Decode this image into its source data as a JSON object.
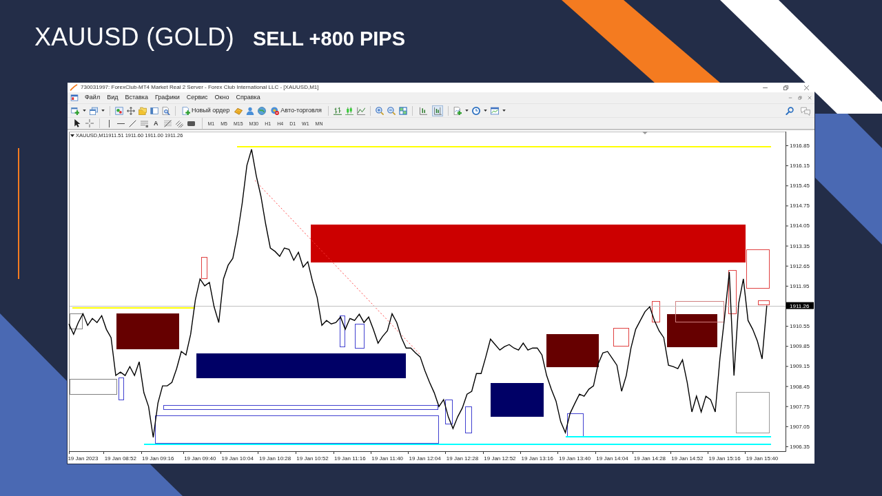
{
  "slide": {
    "title": "XAUUSD (GOLD)",
    "subtitle": "SELL +800 PIPS"
  },
  "window": {
    "title": "730031997: ForexClub-MT4 Market Real 2 Server - Forex Club International LLC - [XAUUSD,M1]"
  },
  "menu": [
    "Файл",
    "Вид",
    "Вставка",
    "Графики",
    "Сервис",
    "Окно",
    "Справка"
  ],
  "toolbar": {
    "order_button": "Новый ордер",
    "autotrading_button": "Авто-торговля",
    "toggles": [
      {
        "pressed": false
      },
      {
        "pressed": true
      }
    ]
  },
  "drawing_toolbar": {
    "text_tool": "A",
    "periods": [
      "M1",
      "M5",
      "M15",
      "M30",
      "H1",
      "H4",
      "D1",
      "W1",
      "MN"
    ]
  },
  "chart": {
    "legend_values": "1911.51 1911.60 1911.00 1911.26",
    "bid_label": "1911.26",
    "chart_data": {
      "type": "line",
      "categories": [
        null,
        null,
        null,
        "19 Jan 2023",
        null,
        null,
        null,
        null,
        null,
        null,
        null,
        "19 Jan 08:52",
        null,
        null,
        null,
        null,
        null,
        null,
        null,
        "19 Jan 09:16",
        null,
        null,
        null,
        null,
        null,
        null,
        null,
        null,
        "19 Jan 09:40",
        null,
        null,
        null,
        null,
        null,
        null,
        null,
        "19 Jan 10:04",
        null,
        null,
        null,
        null,
        null,
        null,
        null,
        "19 Jan 10:28",
        null,
        null,
        null,
        null,
        null,
        null,
        null,
        "19 Jan 10:52",
        null,
        null,
        null,
        null,
        null,
        null,
        null,
        "19 Jan 11:16",
        null,
        null,
        null,
        null,
        null,
        null,
        null,
        "19 Jan 11:40",
        null,
        null,
        null,
        null,
        null,
        null,
        null,
        "19 Jan 12:04",
        null,
        null,
        null,
        null,
        null,
        null,
        null,
        "19 Jan 12:28",
        null,
        null,
        null,
        null,
        null,
        null,
        null,
        "19 Jan 12:52",
        null,
        null,
        null,
        null,
        null,
        null,
        null,
        "19 Jan 13:16",
        null,
        null,
        null,
        null,
        null,
        null,
        null,
        "19 Jan 13:40",
        null,
        null,
        null,
        null,
        null,
        null,
        null,
        "19 Jan 14:04",
        null,
        null,
        null,
        null,
        null,
        null,
        null,
        "19 Jan 14:28",
        null,
        null,
        null,
        null,
        null,
        null,
        null,
        "19 Jan 14:52",
        null,
        null,
        null,
        null,
        null,
        null,
        null,
        "19 Jan 15:16",
        null,
        null,
        null,
        null,
        null,
        null,
        null,
        "19 Jan 15:40",
        null,
        null,
        null,
        null,
        null
      ],
      "series": [
        {
          "name": "XAUUSD,M1",
          "color": "#000000",
          "values": [
            1910.62,
            1910.26,
            1910.67,
            1910.98,
            1910.57,
            1910.81,
            1910.67,
            1910.91,
            1910.43,
            1910.14,
            1908.82,
            1908.94,
            1908.82,
            1909.13,
            1908.82,
            1909.3,
            1908.22,
            1907.74,
            1906.66,
            1907.86,
            1908.46,
            1908.46,
            1908.58,
            1909.06,
            1909.66,
            1909.54,
            1910.26,
            1911.46,
            1912.19,
            1911.95,
            1912.07,
            1911.22,
            1910.67,
            1912.19,
            1912.67,
            1912.91,
            1913.75,
            1914.83,
            1916.15,
            1916.71,
            1915.79,
            1915.07,
            1914.11,
            1913.27,
            1913.15,
            1912.98,
            1913.27,
            1913.22,
            1912.84,
            1913.12,
            1912.6,
            1912.79,
            1912.11,
            1911.54,
            1910.57,
            1910.74,
            1910.62,
            1910.67,
            1910.86,
            1910.43,
            1910.81,
            1910.74,
            1910.96,
            1910.67,
            1910.86,
            1910.43,
            1909.95,
            1910.19,
            1910.38,
            1910.98,
            1910.67,
            1910.14,
            1909.78,
            1909.78,
            1909.61,
            1909.47,
            1908.99,
            1908.58,
            1908.22,
            1907.74,
            1907.98,
            1907.38,
            1906.97,
            1907.38,
            1907.69,
            1908.17,
            1908.27,
            1908.89,
            1908.89,
            1909.47,
            1910.09,
            1909.9,
            1909.71,
            1909.83,
            1909.9,
            1909.78,
            1909.71,
            1909.95,
            1909.71,
            1909.78,
            1909.78,
            1909.54,
            1908.82,
            1908.34,
            1907.93,
            1907.21,
            1906.83,
            1907.5,
            1907.84,
            1908.17,
            1908.1,
            1908.34,
            1908.46,
            1909.23,
            1909.61,
            1909.66,
            1909.42,
            1909.18,
            1908.27,
            1908.82,
            1909.78,
            1910.43,
            1910.74,
            1911.05,
            1911.22,
            1910.74,
            1910.38,
            1910.14,
            1909.18,
            1909.13,
            1909.06,
            1909.37,
            1908.58,
            1907.55,
            1908.1,
            1907.55,
            1908.1,
            1907.98,
            1907.55,
            1909.42,
            1910.86,
            1912.43,
            1908.82,
            1911.34,
            1912.19,
            1910.74,
            1910.43,
            1910.02,
            1909.4,
            1911.26,
            null,
            null,
            null,
            null
          ]
        }
      ],
      "ylim": [
        1906.18,
        1917.33
      ],
      "yticks": [
        {
          "value": 1916.85,
          "label": "1916.85"
        },
        {
          "value": 1916.15,
          "label": "1916.15"
        },
        {
          "value": 1915.45,
          "label": "1915.45"
        },
        {
          "value": 1914.75,
          "label": "1914.75"
        },
        {
          "value": 1914.05,
          "label": "1914.05"
        },
        {
          "value": 1913.35,
          "label": "1913.35"
        },
        {
          "value": 1912.65,
          "label": "1912.65"
        },
        {
          "value": 1911.95,
          "label": "1911.95"
        },
        {
          "value": 1910.55,
          "label": "1910.55"
        },
        {
          "value": 1909.85,
          "label": "1909.85"
        },
        {
          "value": 1909.15,
          "label": "1909.15"
        },
        {
          "value": 1908.45,
          "label": "1908.45"
        },
        {
          "value": 1907.75,
          "label": "1907.75"
        },
        {
          "value": 1907.05,
          "label": "1907.05"
        },
        {
          "value": 1906.35,
          "label": "1906.35"
        }
      ]
    }
  }
}
